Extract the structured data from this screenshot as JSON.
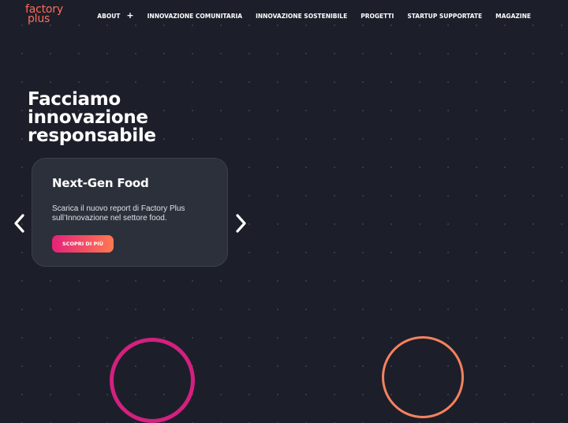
{
  "brand": {
    "logo_line1": "factory",
    "logo_line2": "plus",
    "color": "#ff6b5a"
  },
  "nav": {
    "items": [
      {
        "label": "ABOUT",
        "icon": "plus-icon"
      },
      {
        "label": "INNOVAZIONE COMUNITARIA"
      },
      {
        "label": "INNOVAZIONE SOSTENIBILE"
      },
      {
        "label": "PROGETTI"
      },
      {
        "label": "STARTUP SUPPORTATE"
      },
      {
        "label": "MAGAZINE"
      }
    ]
  },
  "hero": {
    "title_line1": "Facciamo",
    "title_line2": "innovazione",
    "title_line3": "responsabile"
  },
  "slide": {
    "title": "Next-Gen Food",
    "text": "Scarica il nuovo report di Factory Plus sull’Innovazione nel settore food.",
    "button_label": "SCOPRI DI PIÙ"
  },
  "carousel": {
    "prev_icon": "chevron-left-icon",
    "next_icon": "chevron-right-icon"
  },
  "colors": {
    "background": "#1c1f2a",
    "card": "#2c303b",
    "accent_gradient_start": "#e4227a",
    "accent_gradient_end": "#ff7950",
    "ring_pink": "#d4207f",
    "ring_orange": "#f4825f"
  }
}
